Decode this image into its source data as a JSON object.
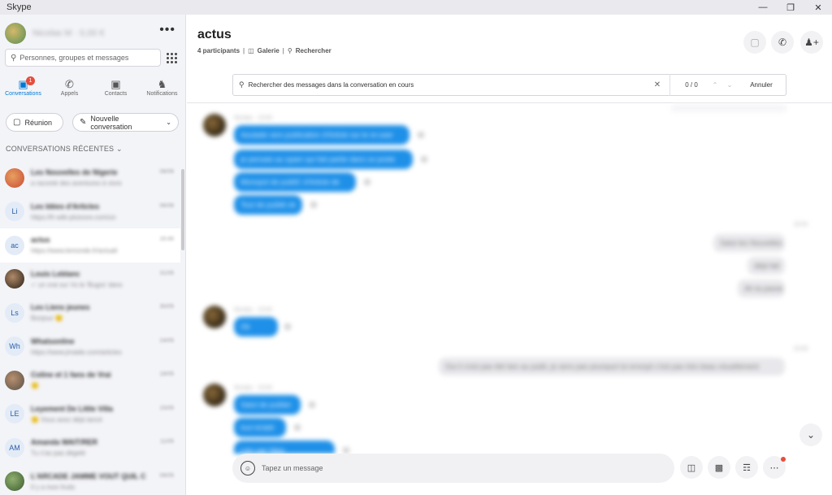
{
  "window": {
    "title": "Skype",
    "controls": [
      "—",
      "❐",
      "✕"
    ]
  },
  "sidebar": {
    "profile_name": "Nicolas M · 0,00 €",
    "more": "•••",
    "search_placeholder": "Personnes, groupes et messages",
    "tabs": [
      {
        "label": "Conversations",
        "icon": "chat-icon",
        "glyph": "💬",
        "badge": "1"
      },
      {
        "label": "Appels",
        "icon": "phone-icon",
        "glyph": "✆"
      },
      {
        "label": "Contacts",
        "icon": "contacts-icon",
        "glyph": "▣"
      },
      {
        "label": "Notifications",
        "icon": "bell-icon",
        "glyph": "🔔"
      }
    ],
    "meeting_label": "Réunion",
    "new_conversation_label": "Nouvelle conversation",
    "recent_header": "CONVERSATIONS RÉCENTES",
    "conversations": [
      {
        "initials": "",
        "title": "Les Nouvelles de Nigerie",
        "snippet": "a raconté des aventures à vivre",
        "time": "08/06"
      },
      {
        "initials": "Li",
        "title": "Les Idées d'Articles",
        "snippet": "https://fr-wiki-plutvore.com/un",
        "time": "06/06"
      },
      {
        "initials": "ac",
        "title": "actus",
        "snippet": "https://www.lemonde.fr/actuali",
        "time": "15:00"
      },
      {
        "initials": "",
        "title": "Louis Leblanc",
        "snippet": "✓ un vrai sur Vs le 'Bugra' dans",
        "time": "31/05"
      },
      {
        "initials": "Ls",
        "title": "Les Liens jeunes",
        "snippet": "Bonjour 🙂",
        "time": "30/05"
      },
      {
        "initials": "Wh",
        "title": "Whatsonline",
        "snippet": "https://www.jmaide.com/articles",
        "time": "24/05"
      },
      {
        "initials": "",
        "title": "Coline et 1 fans de Vrai",
        "snippet": "🙂",
        "time": "18/05"
      },
      {
        "initials": "LE",
        "title": "Leyement De Little Villa",
        "snippet": "🙂 Vous avez déjà lancé",
        "time": "15/05"
      },
      {
        "initials": "AM",
        "title": "Amanda WAIT/RER",
        "snippet": "Tu n'as pas dégelé",
        "time": "11/05"
      },
      {
        "initials": "",
        "title": "L'ARCADE JAMME VOUT QUIL C",
        "snippet": "Il y a mon fruits",
        "time": "09/05"
      }
    ]
  },
  "chat": {
    "title": "actus",
    "participants": "4 participants",
    "gallery": "Galerie",
    "search": "Rechercher",
    "find_placeholder": "Rechercher des messages dans la conversation en cours",
    "find_count": "0 / 0",
    "find_cancel": "Annuler",
    "composer_placeholder": "Tapez un message",
    "messages_in_1": [
      "Aoulade vers publication d'Article sur le re-user",
      "je pensais au spam qui fait partie dans ce poste",
      "Monopol de publiC d'Article de",
      "Tout de publié ok"
    ],
    "messages_out_1": [
      "Salut les Nouvelles",
      "déjà fait",
      "Ah ta passe"
    ],
    "messages_in_2": [
      "Ok"
    ],
    "messages_out_2": [
      "Oui il s'est pas été ben au publi, je sens pas pourquoi lui envoyé c'est pas très beau visuellement"
    ],
    "messages_in_3": [
      "Salut de publier",
      "tout éclaté",
      "Lien par https"
    ],
    "sender_name": "Nicolas · 15:00",
    "time_a": "15:04",
    "time_b": "15:09"
  }
}
